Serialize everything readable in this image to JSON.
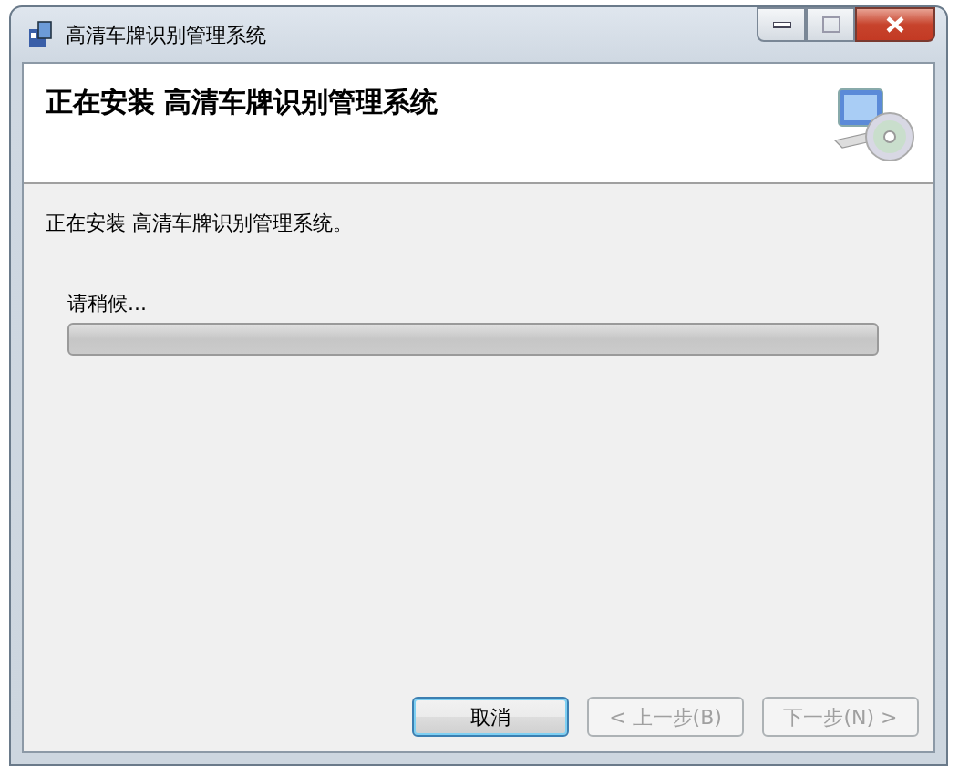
{
  "window": {
    "title": "高清车牌识别管理系统"
  },
  "header": {
    "title": "正在安装  高清车牌识别管理系统"
  },
  "body": {
    "message": "正在安装 高清车牌识别管理系统。",
    "progress_label": "请稍候...",
    "progress": {
      "level": 0
    }
  },
  "buttons": [
    {
      "label": "取消",
      "disabled": false,
      "default": true
    },
    {
      "label": "< 上一步(B)",
      "disabled": true,
      "default": false
    },
    {
      "label": "下一步(N) >",
      "disabled": true,
      "default": false
    }
  ]
}
